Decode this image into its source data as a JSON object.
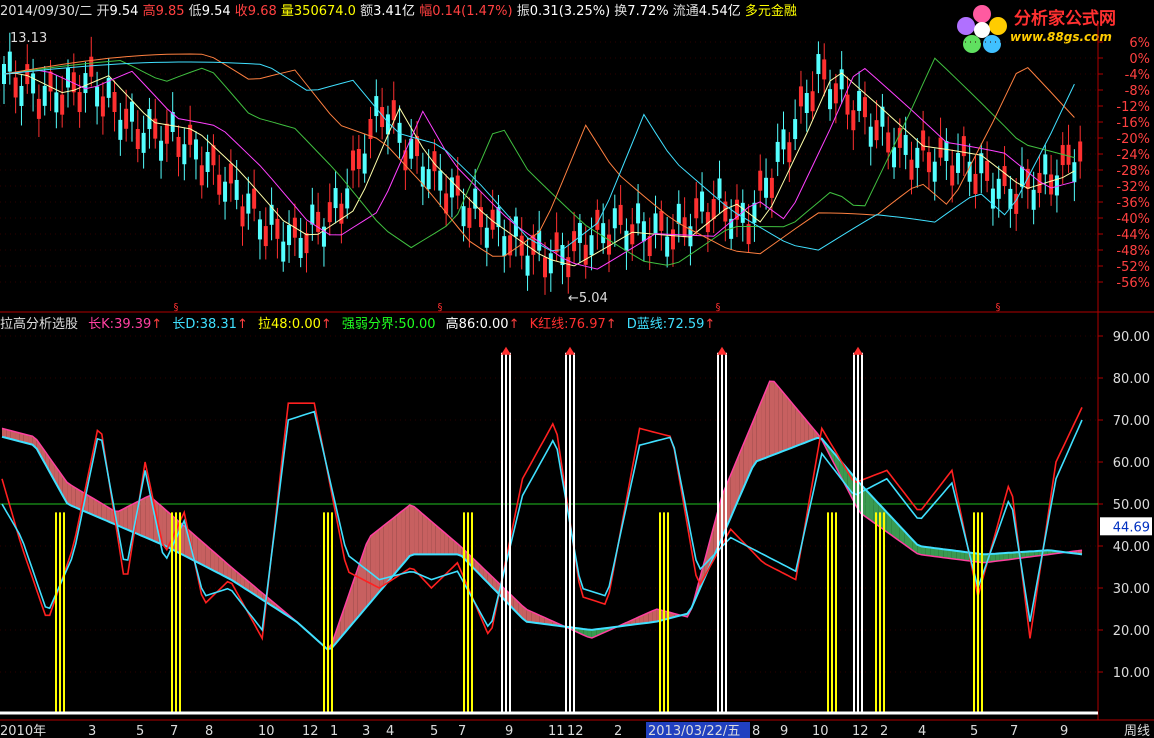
{
  "header": {
    "date": "2014/09/30/二",
    "open_label": "开",
    "open": "9.54",
    "high_label": "高",
    "high": "9.85",
    "low_label": "低",
    "low": "9.54",
    "close_label": "收",
    "close": "9.68",
    "vol_label": "量",
    "vol": "350674.0",
    "amt_label": "额",
    "amt": "3.41亿",
    "chg_label": "幅",
    "chg": "0.14(1.47%)",
    "amp_label": "振",
    "amp": "0.31(3.25%)",
    "turn_label": "换",
    "turn": "7.72%",
    "float_label": "流通",
    "float": "4.54亿",
    "stock_name": "多元金融"
  },
  "watermark": {
    "title": "分析家公式网",
    "url": "www.88gs.com"
  },
  "price_panel": {
    "high_marker": "13.13",
    "low_marker": "←5.04",
    "y_ticks": [
      "6%",
      "0%",
      "-4%",
      "-8%",
      "-12%",
      "-16%",
      "-20%",
      "-24%",
      "-28%",
      "-32%",
      "-36%",
      "-40%",
      "-44%",
      "-48%",
      "-52%",
      "-56%"
    ]
  },
  "indicator": {
    "name": "拉高分析选股",
    "k_label": "长K:",
    "k_value": "39.39",
    "d_label": "长D:",
    "d_value": "38.31",
    "la_label": "拉48:",
    "la_value": "0.00",
    "qr_label": "强弱分界:",
    "qr_value": "50.00",
    "gao_label": "高86:",
    "gao_value": "0.00",
    "kred_label": "K红线:",
    "kred_value": "76.97",
    "dblue_label": "D蓝线:",
    "dblue_value": "72.59",
    "arrow": "↑",
    "y_ticks": [
      "90.00",
      "80.00",
      "70.00",
      "60.00",
      "50.00",
      "40.00",
      "30.00",
      "20.00",
      "10.00"
    ],
    "current_value": "44.69"
  },
  "x_axis": {
    "labels": [
      "2010年",
      "3",
      "5",
      "7",
      "8",
      "10",
      "12",
      "1",
      "3",
      "4",
      "5",
      "7",
      "9",
      "11",
      "12",
      "2",
      "2013/03/22/五",
      "8",
      "9",
      "10",
      "12",
      "2",
      "4",
      "5",
      "7",
      "9"
    ],
    "period": "周线"
  },
  "colors": {
    "up": "#ff3030",
    "down": "#54ffff",
    "k": "#ff2020",
    "d": "#40e0ff",
    "fill_green": "#3a9a50",
    "fill_red": "#c76060",
    "yellow": "#ffff00",
    "grid": "#b00000"
  }
}
